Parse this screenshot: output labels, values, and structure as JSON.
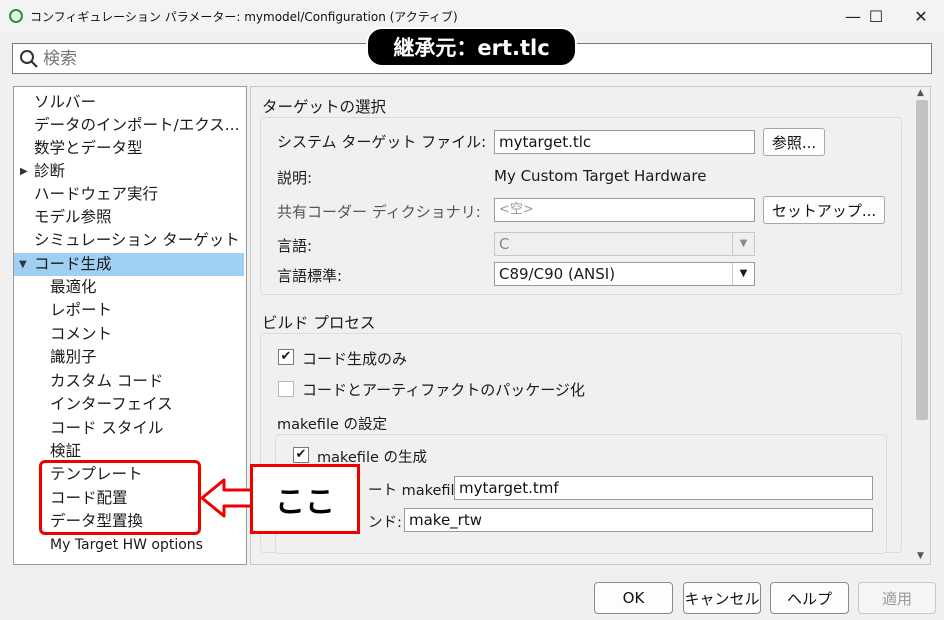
{
  "window": {
    "title": "コンフィギュレーション パラメーター: mymodel/Configuration (アクティブ)",
    "minimize": "—",
    "maximize": "☐",
    "close": "✕"
  },
  "inherit_badge": "継承元：ert.tlc",
  "search": {
    "placeholder": "検索",
    "value": ""
  },
  "tree": {
    "items": [
      {
        "label": "ソルバー",
        "indent": 0,
        "caret": ""
      },
      {
        "label": "データのインポート/エクスポート",
        "display": "データのインポート/エクス...",
        "indent": 0,
        "caret": ""
      },
      {
        "label": "数学とデータ型",
        "indent": 0,
        "caret": ""
      },
      {
        "label": "診断",
        "indent": 0,
        "caret": "▶"
      },
      {
        "label": "ハードウェア実行",
        "indent": 0,
        "caret": ""
      },
      {
        "label": "モデル参照",
        "indent": 0,
        "caret": ""
      },
      {
        "label": "シミュレーション ターゲット",
        "indent": 0,
        "caret": ""
      },
      {
        "label": "コード生成",
        "indent": 0,
        "caret": "▼",
        "selected": true
      },
      {
        "label": "最適化",
        "indent": 1
      },
      {
        "label": "レポート",
        "indent": 1
      },
      {
        "label": "コメント",
        "indent": 1
      },
      {
        "label": "識別子",
        "indent": 1
      },
      {
        "label": "カスタム コード",
        "indent": 1
      },
      {
        "label": "インターフェイス",
        "indent": 1
      },
      {
        "label": "コード スタイル",
        "indent": 1
      },
      {
        "label": "検証",
        "indent": 1
      },
      {
        "label": "テンプレート",
        "indent": 1
      },
      {
        "label": "コード配置",
        "indent": 1
      },
      {
        "label": "データ型置換",
        "indent": 1
      },
      {
        "label": "My Target HW options",
        "indent": 1
      }
    ]
  },
  "target_section": {
    "title": "ターゲットの選択",
    "system_target_label": "システム ターゲット ファイル:",
    "system_target_value": "mytarget.tlc",
    "browse_button": "参照...",
    "description_label": "説明:",
    "description_value": "My Custom Target Hardware",
    "shared_dict_label": "共有コーダー ディクショナリ:",
    "shared_dict_placeholder": "<空>",
    "setup_button": "セットアップ...",
    "language_label": "言語:",
    "language_value": "C",
    "language_std_label": "言語標準:",
    "language_std_value": "C89/C90 (ANSI)"
  },
  "build_section": {
    "title": "ビルド プロセス",
    "codegen_only_label": "コード生成のみ",
    "codegen_only_checked": true,
    "package_label": "コードとアーティファクトのパッケージ化",
    "package_checked": false,
    "makefile_group_title": "makefile の設定",
    "gen_makefile_label": "makefile の生成",
    "gen_makefile_checked": true,
    "template_makefile_label": "ート makefile:",
    "template_makefile_value": "mytarget.tmf",
    "make_command_label": "ンド:",
    "make_command_value": "make_rtw"
  },
  "buttons": {
    "ok": "OK",
    "cancel": "キャンセル",
    "help": "ヘルプ",
    "apply": "適用"
  },
  "annotation": {
    "callout_text": "ここ",
    "highlight_color": "#e00000"
  }
}
